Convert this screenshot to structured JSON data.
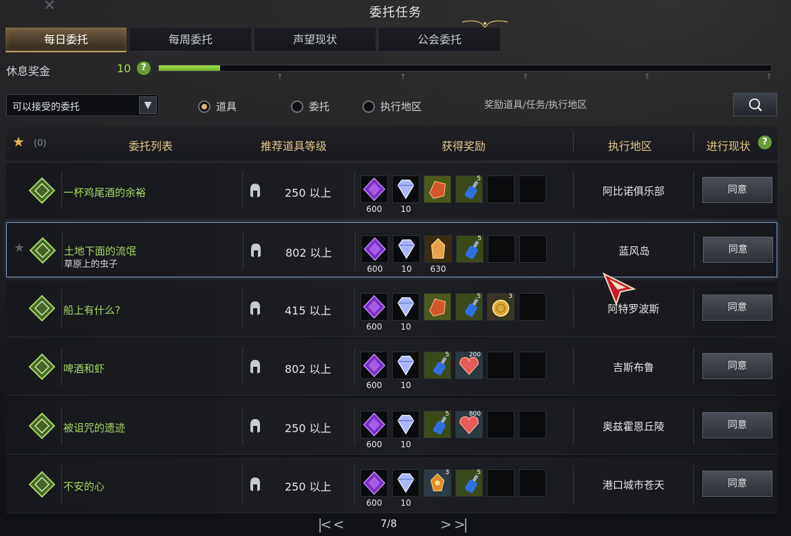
{
  "window": {
    "title": "委托任务",
    "close_label": "✕"
  },
  "tabs": [
    {
      "label": "每日委托",
      "active": true
    },
    {
      "label": "每周委托",
      "active": false
    },
    {
      "label": "声望现状",
      "active": false
    },
    {
      "label": "公会委托",
      "active": false
    }
  ],
  "rest_bonus": {
    "label": "休息奖金",
    "value": "10",
    "fill_fraction": 0.1
  },
  "filter": {
    "dropdown_value": "可以接受的委托",
    "radio_options": [
      {
        "label": "道具",
        "selected": true
      },
      {
        "label": "委托",
        "selected": false
      },
      {
        "label": "执行地区",
        "selected": false
      }
    ],
    "search_placeholder": "奖励道具/任务/执行地区"
  },
  "list_header": {
    "fav_count": "(0)",
    "col_list": "委托列表",
    "col_level": "推荐道具等级",
    "col_reward": "获得奖励",
    "col_region": "执行地区",
    "col_status": "进行现状"
  },
  "rows": [
    {
      "name": "一杯鸡尾酒的余裕",
      "sub": "",
      "level": "250 以上",
      "region": "阿比诺俱乐部",
      "accept": "同意",
      "selected": false,
      "rewards": [
        {
          "icon": "purple-crystal-icon",
          "count": "600",
          "stack": ""
        },
        {
          "icon": "diamond-gem-icon",
          "count": "10",
          "stack": ""
        },
        {
          "icon": "red-ore-icon",
          "count": "",
          "stack": ""
        },
        {
          "icon": "blue-potion-icon",
          "count": "",
          "stack": "5"
        },
        {
          "icon": "empty-slot-icon",
          "count": "",
          "stack": ""
        },
        {
          "icon": "empty-slot-icon",
          "count": "",
          "stack": ""
        }
      ]
    },
    {
      "name": "土地下面的流氓",
      "sub": "草原上的虫子",
      "level": "802 以上",
      "region": "蓝风岛",
      "accept": "同意",
      "selected": true,
      "rewards": [
        {
          "icon": "purple-crystal-icon",
          "count": "600",
          "stack": ""
        },
        {
          "icon": "diamond-gem-icon",
          "count": "10",
          "stack": ""
        },
        {
          "icon": "amber-shard-icon",
          "count": "630",
          "stack": ""
        },
        {
          "icon": "blue-potion-icon",
          "count": "",
          "stack": "5"
        },
        {
          "icon": "empty-slot-icon",
          "count": "",
          "stack": ""
        },
        {
          "icon": "empty-slot-icon",
          "count": "",
          "stack": ""
        }
      ]
    },
    {
      "name": "船上有什么?",
      "sub": "",
      "level": "415 以上",
      "region": "阿特罗波斯",
      "accept": "同意",
      "selected": false,
      "rewards": [
        {
          "icon": "purple-crystal-icon",
          "count": "600",
          "stack": ""
        },
        {
          "icon": "diamond-gem-icon",
          "count": "10",
          "stack": ""
        },
        {
          "icon": "red-ore-icon",
          "count": "",
          "stack": ""
        },
        {
          "icon": "blue-potion-icon",
          "count": "",
          "stack": "5"
        },
        {
          "icon": "gold-coin-icon",
          "count": "",
          "stack": "3"
        },
        {
          "icon": "empty-slot-icon",
          "count": "",
          "stack": ""
        }
      ]
    },
    {
      "name": "啤酒和虾",
      "sub": "",
      "level": "802 以上",
      "region": "吉斯布鲁",
      "accept": "同意",
      "selected": false,
      "rewards": [
        {
          "icon": "purple-crystal-icon",
          "count": "600",
          "stack": ""
        },
        {
          "icon": "diamond-gem-icon",
          "count": "10",
          "stack": ""
        },
        {
          "icon": "blue-potion-icon",
          "count": "",
          "stack": "5"
        },
        {
          "icon": "red-heart-stone-icon",
          "count": "",
          "stack": "200"
        },
        {
          "icon": "empty-slot-icon",
          "count": "",
          "stack": ""
        },
        {
          "icon": "empty-slot-icon",
          "count": "",
          "stack": ""
        }
      ]
    },
    {
      "name": "被诅咒的遗迹",
      "sub": "",
      "level": "250 以上",
      "region": "奥兹霍恩丘陵",
      "accept": "同意",
      "selected": false,
      "rewards": [
        {
          "icon": "purple-crystal-icon",
          "count": "600",
          "stack": ""
        },
        {
          "icon": "diamond-gem-icon",
          "count": "10",
          "stack": ""
        },
        {
          "icon": "blue-potion-icon",
          "count": "",
          "stack": "5"
        },
        {
          "icon": "red-heart-stone-icon",
          "count": "",
          "stack": "800"
        },
        {
          "icon": "empty-slot-icon",
          "count": "",
          "stack": ""
        },
        {
          "icon": "empty-slot-icon",
          "count": "",
          "stack": ""
        }
      ]
    },
    {
      "name": "不安的心",
      "sub": "",
      "level": "250 以上",
      "region": "港口城市苍天",
      "accept": "同意",
      "selected": false,
      "rewards": [
        {
          "icon": "purple-crystal-icon",
          "count": "600",
          "stack": ""
        },
        {
          "icon": "diamond-gem-icon",
          "count": "10",
          "stack": ""
        },
        {
          "icon": "gold-cluster-icon",
          "count": "",
          "stack": "3"
        },
        {
          "icon": "blue-potion-icon",
          "count": "",
          "stack": "5"
        },
        {
          "icon": "empty-slot-icon",
          "count": "",
          "stack": ""
        },
        {
          "icon": "empty-slot-icon",
          "count": "",
          "stack": ""
        }
      ]
    }
  ],
  "pager": {
    "current": "7/8"
  },
  "colors": {
    "accent_gold": "#e2c48c",
    "quest_green": "#a7d764",
    "bar_green": "#8fd03c",
    "selected_border": "#7896bf"
  }
}
